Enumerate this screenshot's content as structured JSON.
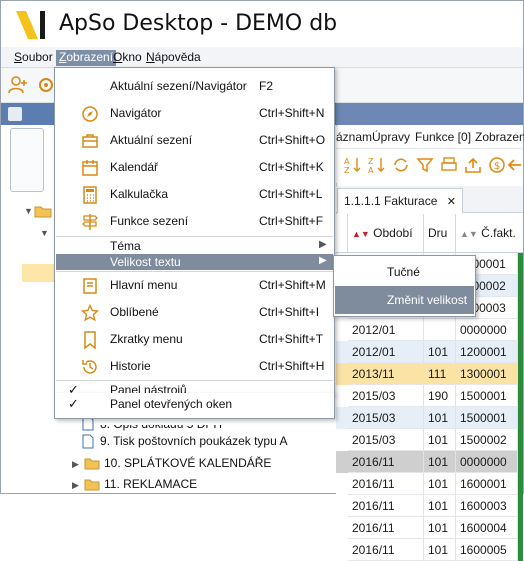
{
  "app": {
    "title": "ApSo Desktop - DEMO db"
  },
  "menubar": {
    "items": [
      {
        "label": "Soubor",
        "key": "S"
      },
      {
        "label": "Zobrazení",
        "key": "Z"
      },
      {
        "label": "Okno",
        "key": "O"
      },
      {
        "label": "Nápověda",
        "key": "N"
      }
    ]
  },
  "zobrazeni_menu": {
    "items": [
      {
        "label": "Aktuální sezení/Navigátor",
        "shortcut": "F2"
      },
      {
        "label": "Navigátor",
        "shortcut": "Ctrl+Shift+N"
      },
      {
        "label": "Aktuální sezení",
        "shortcut": "Ctrl+Shift+O"
      },
      {
        "label": "Kalendář",
        "shortcut": "Ctrl+Shift+K"
      },
      {
        "label": "Kalkulačka",
        "shortcut": "Ctrl+Shift+L"
      },
      {
        "label": "Funkce sezení",
        "shortcut": "Ctrl+Shift+F"
      }
    ],
    "tema": "Téma",
    "velikost_textu": "Velikost textu",
    "items2": [
      {
        "label": "Hlavní menu",
        "shortcut": "Ctrl+Shift+M"
      },
      {
        "label": "Oblíbené",
        "shortcut": "Ctrl+Shift+I"
      },
      {
        "label": "Zkratky menu",
        "shortcut": "Ctrl+Shift+T"
      },
      {
        "label": "Historie",
        "shortcut": "Ctrl+Shift+H"
      }
    ],
    "checks": [
      {
        "label": "Panel nástrojů",
        "checked": true
      },
      {
        "label": "Panel otevřených oken",
        "checked": true
      }
    ]
  },
  "velikost_submenu": {
    "items": [
      "Tučné",
      "Změnit velikost"
    ]
  },
  "right": {
    "menubar": [
      "áznam",
      "Úpravy",
      "Funkce [0]",
      "Zobrazení"
    ],
    "tab": "1.1.1.1 Fakturace",
    "columns": [
      "Období",
      "Dru",
      "Č.fakt."
    ],
    "rows": [
      {
        "obdobi": "",
        "dru": "",
        "fakt": "1100001",
        "style": "normal"
      },
      {
        "obdobi": "",
        "dru": "",
        "fakt": "1100002",
        "style": "alt"
      },
      {
        "obdobi": "",
        "dru": "",
        "fakt": "1100003",
        "style": "normal"
      },
      {
        "obdobi": "2012/01",
        "dru": "",
        "fakt": "0000000",
        "style": "normal"
      },
      {
        "obdobi": "2012/01",
        "dru": "101",
        "fakt": "1200001",
        "style": "alt"
      },
      {
        "obdobi": "2013/11",
        "dru": "111",
        "fakt": "1300001",
        "style": "selected"
      },
      {
        "obdobi": "2015/03",
        "dru": "190",
        "fakt": "1500001",
        "style": "normal"
      },
      {
        "obdobi": "2015/03",
        "dru": "101",
        "fakt": "1500001",
        "style": "alt"
      },
      {
        "obdobi": "2015/03",
        "dru": "101",
        "fakt": "1500002",
        "style": "normal"
      },
      {
        "obdobi": "2016/11",
        "dru": "101",
        "fakt": "0000000",
        "style": "gray"
      },
      {
        "obdobi": "2016/11",
        "dru": "101",
        "fakt": "1600001",
        "style": "normal"
      },
      {
        "obdobi": "2016/11",
        "dru": "101",
        "fakt": "1600003",
        "style": "normal"
      },
      {
        "obdobi": "2016/11",
        "dru": "101",
        "fakt": "1600004",
        "style": "normal"
      },
      {
        "obdobi": "2016/11",
        "dru": "101",
        "fakt": "1600005",
        "style": "normal"
      }
    ]
  },
  "tree": {
    "items": [
      {
        "label": "8. Opis dokladu 5 DPH"
      },
      {
        "label": "9. Tisk poštovních poukázek typu A"
      },
      {
        "label": "10. SPLÁTKOVÉ KALENDÁŘE"
      },
      {
        "label": "11. REKLAMACE"
      }
    ]
  },
  "colors": {
    "highlight": "#7f8c9d",
    "selected_row": "#fbe3a6",
    "tree_selected": "#fde6a8",
    "accent_blue": "#5b7db0",
    "status_green": "#2e8b3e",
    "logo_yellow": "#f6c21a"
  }
}
